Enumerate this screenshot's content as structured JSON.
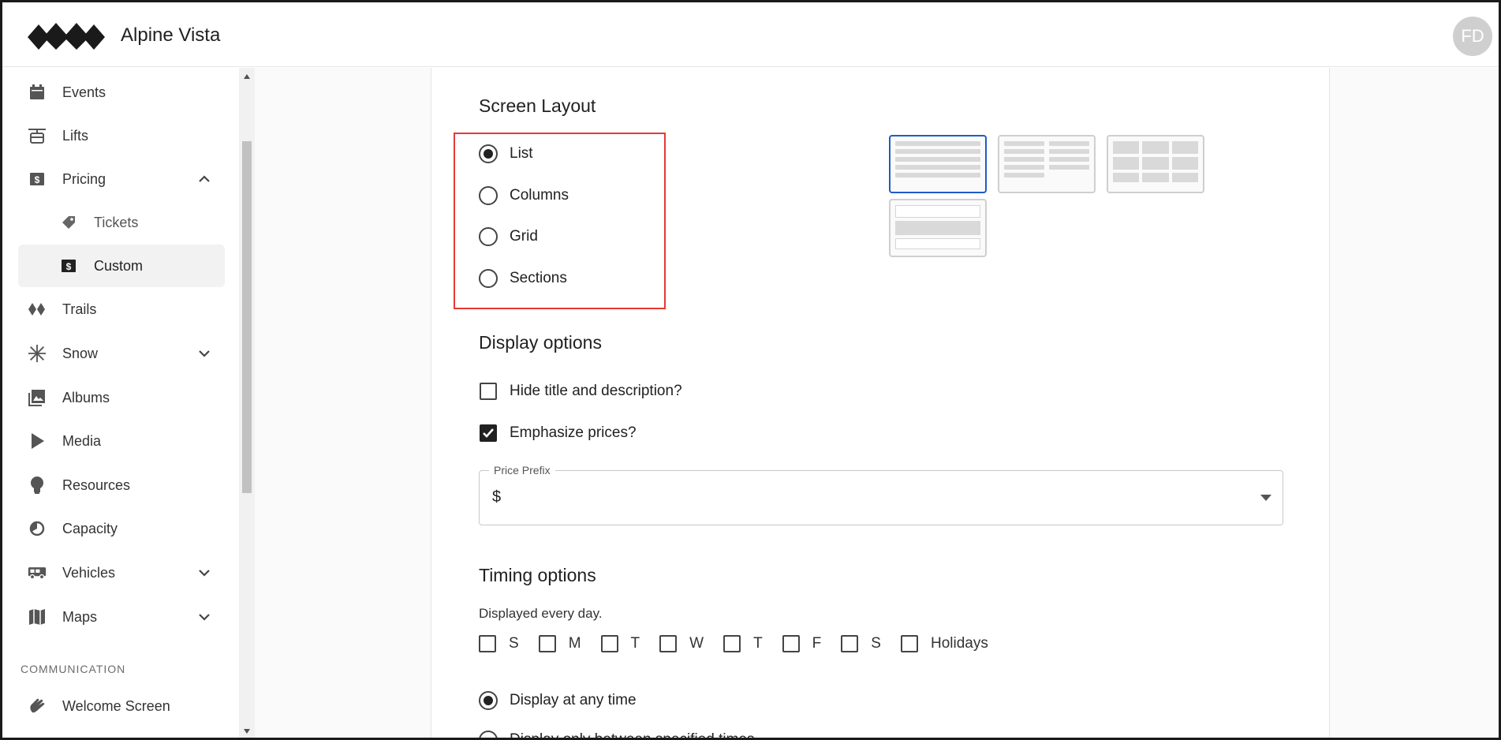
{
  "app": {
    "title": "Alpine Vista",
    "avatar_initials": "FD"
  },
  "sidebar": {
    "items": [
      {
        "label": "Events",
        "icon": "calendar-icon"
      },
      {
        "label": "Lifts",
        "icon": "gondola-icon"
      },
      {
        "label": "Pricing",
        "icon": "dollar-badge-icon",
        "expanded": true
      },
      {
        "label": "Tickets",
        "icon": "tag-icon"
      },
      {
        "label": "Custom",
        "icon": "dollar-badge-icon",
        "active": true
      },
      {
        "label": "Trails",
        "icon": "diamonds-icon"
      },
      {
        "label": "Snow",
        "icon": "snowflake-icon"
      },
      {
        "label": "Albums",
        "icon": "photos-icon"
      },
      {
        "label": "Media",
        "icon": "play-icon"
      },
      {
        "label": "Resources",
        "icon": "lightbulb-icon"
      },
      {
        "label": "Capacity",
        "icon": "gauge-icon"
      },
      {
        "label": "Vehicles",
        "icon": "bus-icon"
      },
      {
        "label": "Maps",
        "icon": "map-icon"
      },
      {
        "label": "Welcome Screen",
        "icon": "wave-hand-icon"
      }
    ],
    "section_communication": "COMMUNICATION"
  },
  "screen_layout": {
    "title": "Screen Layout",
    "options": [
      "List",
      "Columns",
      "Grid",
      "Sections"
    ],
    "selected": "List"
  },
  "display_options": {
    "title": "Display options",
    "hide_title": {
      "label": "Hide title and description?",
      "checked": false
    },
    "emphasize_prices": {
      "label": "Emphasize prices?",
      "checked": true
    },
    "price_prefix": {
      "label": "Price Prefix",
      "value": "$"
    }
  },
  "timing_options": {
    "title": "Timing options",
    "summary": "Displayed every day.",
    "days": [
      "S",
      "M",
      "T",
      "W",
      "T",
      "F",
      "S",
      "Holidays"
    ],
    "display_any_time": "Display at any time",
    "display_between": "Display only between specified times"
  },
  "colors": {
    "accent": "#1e5bc6",
    "highlight": "#e53935",
    "check_fill": "#212121"
  }
}
